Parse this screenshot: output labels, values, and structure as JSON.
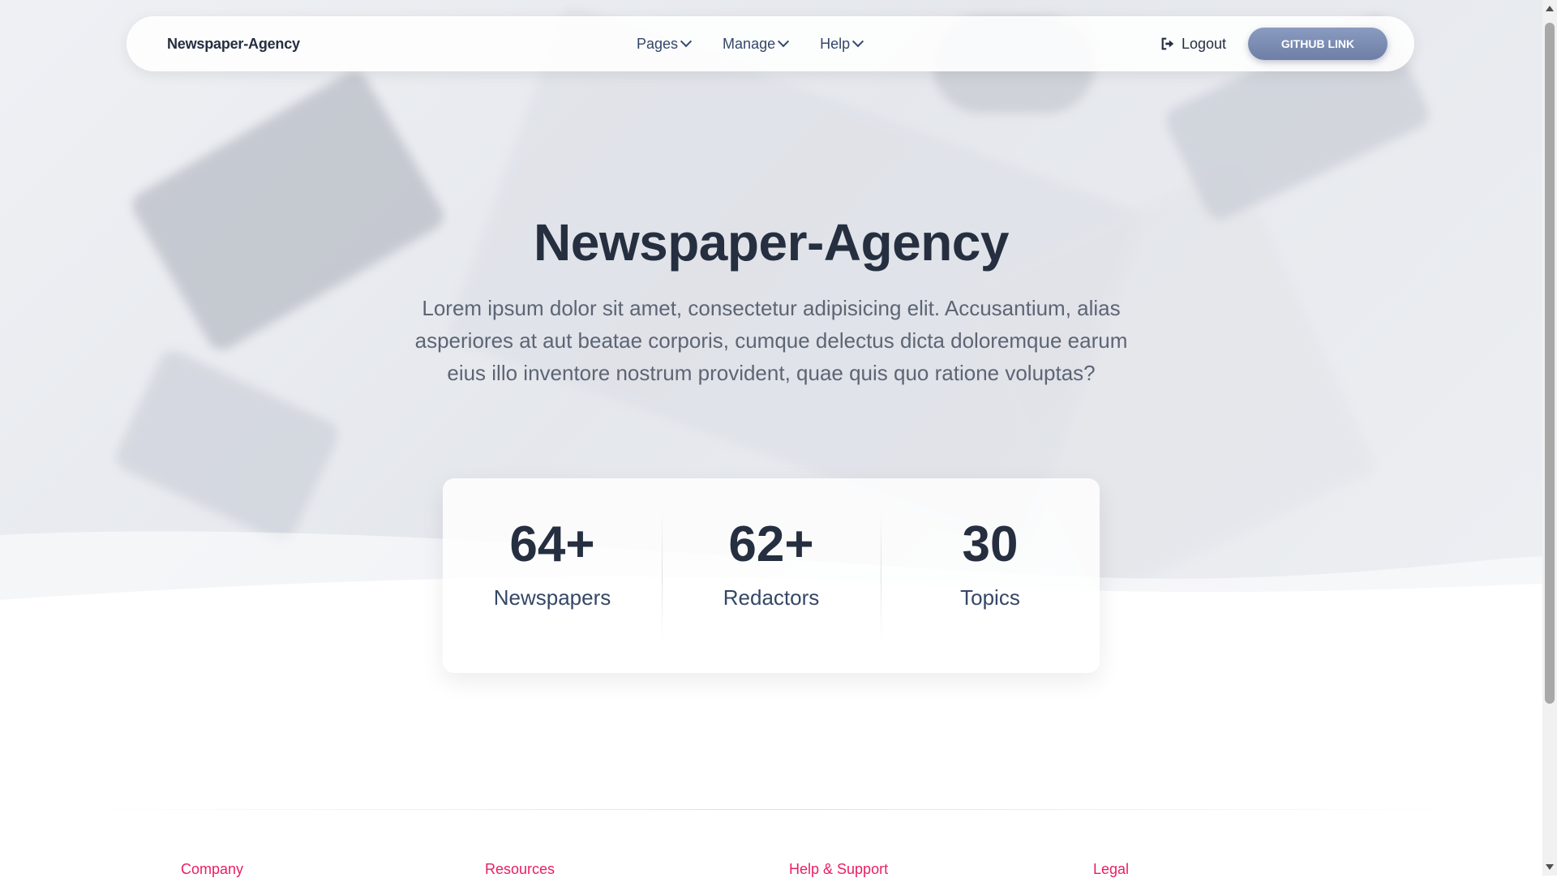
{
  "navbar": {
    "brand": "Newspaper-Agency",
    "menu": [
      {
        "label": "Pages"
      },
      {
        "label": "Manage"
      },
      {
        "label": "Help"
      }
    ],
    "logout_label": "Logout",
    "github_label": "GITHUB LINK"
  },
  "hero": {
    "title": "Newspaper-Agency",
    "subtitle": "Lorem ipsum dolor sit amet, consectetur adipisicing elit. Accusantium, alias asperiores at aut beatae corporis, cumque delectus dicta doloremque earum eius illo inventore nostrum provident, quae quis quo ratione voluptas?"
  },
  "stats": [
    {
      "value": "64+",
      "label": "Newspapers"
    },
    {
      "value": "62+",
      "label": "Redactors"
    },
    {
      "value": "30",
      "label": "Topics"
    }
  ],
  "footer": {
    "columns": [
      "Company",
      "Resources",
      "Help & Support",
      "Legal"
    ]
  },
  "colors": {
    "accent": "#e91e63",
    "text_dark": "#252f40",
    "button": "#7b8bb3"
  }
}
